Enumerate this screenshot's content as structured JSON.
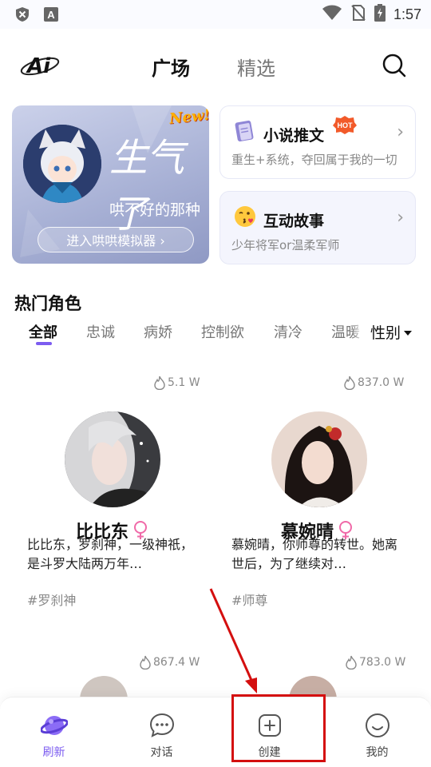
{
  "status_bar": {
    "time": "1:57",
    "icons": [
      "shield-icon",
      "app-a-icon",
      "wifi-icon",
      "no-sim-icon",
      "battery-charging-icon"
    ]
  },
  "top_nav": {
    "logo_text": "Ai",
    "tabs": [
      {
        "label": "广场",
        "active": true
      },
      {
        "label": "精选",
        "active": false
      }
    ]
  },
  "banner": {
    "badge": "New!",
    "title": "生气了",
    "subtitle": "哄不好的那种",
    "button_label": "进入哄哄模拟器 ›"
  },
  "cards": {
    "novel": {
      "title": "小说推文",
      "badge": "HOT",
      "desc": "重生+系统，夺回属于我的一切"
    },
    "story": {
      "title": "互动故事",
      "desc": "少年将军or温柔军师"
    }
  },
  "section": {
    "title": "热门角色"
  },
  "filters": {
    "chips": [
      "全部",
      "忠诚",
      "病娇",
      "控制欲",
      "清冷",
      "温暖"
    ],
    "active": "全部",
    "gender_label": "性别"
  },
  "characters": [
    {
      "name": "比比东",
      "count": "5.1 W",
      "desc": "比比东，罗刹神，一级神祇，是斗罗大陆两万年…",
      "tag": "#罗刹神"
    },
    {
      "name": "慕婉晴",
      "count": "837.0 W",
      "desc": "慕婉晴，你师尊的转世。她离世后，为了继续对…",
      "tag": "#师尊"
    },
    {
      "count": "867.4 W"
    },
    {
      "count": "783.0 W"
    }
  ],
  "bottom_nav": [
    {
      "label": "刷新",
      "icon": "planet-icon",
      "active": true
    },
    {
      "label": "对话",
      "icon": "chat-bubble-icon",
      "active": false
    },
    {
      "label": "创建",
      "icon": "add-square-icon",
      "active": false
    },
    {
      "label": "我的",
      "icon": "smiley-icon",
      "active": false
    }
  ],
  "colors": {
    "accent": "#7c5cf0",
    "annotation": "#d40f0f",
    "female": "#f06aa8"
  }
}
